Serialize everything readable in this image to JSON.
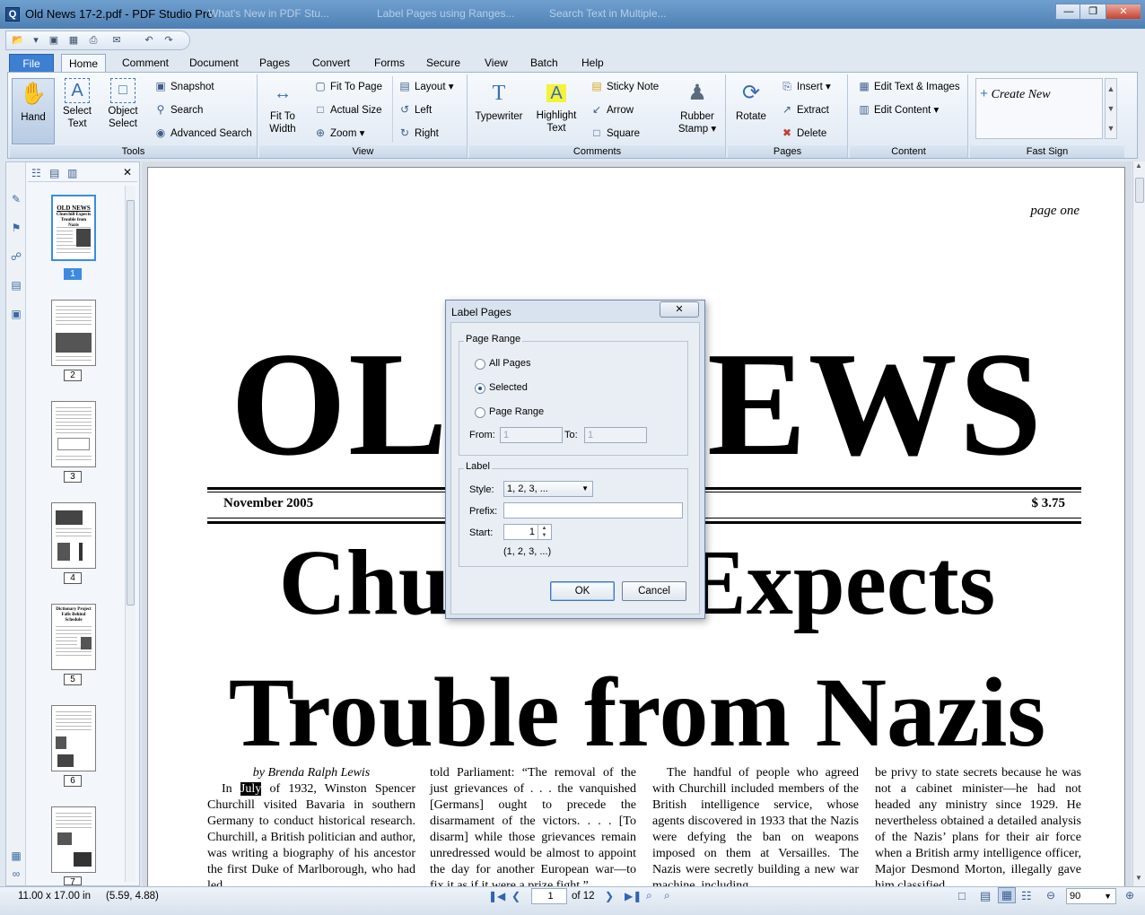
{
  "window": {
    "title": "Old News 17-2.pdf - PDF Studio Pro",
    "ghost_tabs": [
      "What's New in PDF Stu...",
      "Label Pages using Ranges...",
      "Search Text in Multiple..."
    ]
  },
  "menu_tabs": [
    "File",
    "Home",
    "Comment",
    "Document",
    "Pages",
    "Convert",
    "Forms",
    "Secure",
    "View",
    "Batch",
    "Help"
  ],
  "ribbon": {
    "tools": {
      "label": "Tools",
      "hand": "Hand",
      "select_text": "Select Text",
      "object_select": "Object Select",
      "snapshot": "Snapshot",
      "search": "Search",
      "advanced_search": "Advanced Search"
    },
    "view": {
      "label": "View",
      "fit_to_width": "Fit To Width",
      "fit_to_page": "Fit To Page",
      "actual_size": "Actual Size",
      "zoom": "Zoom",
      "layout": "Layout",
      "left": "Left",
      "right": "Right"
    },
    "comments": {
      "label": "Comments",
      "typewriter": "Typewriter",
      "highlight_text": "Highlight Text",
      "sticky_note": "Sticky Note",
      "arrow": "Arrow",
      "square": "Square",
      "rubber_stamp": "Rubber Stamp"
    },
    "pages": {
      "label": "Pages",
      "rotate": "Rotate",
      "insert": "Insert",
      "extract": "Extract",
      "delete": "Delete"
    },
    "content": {
      "label": "Content",
      "edit_text_images": "Edit Text & Images",
      "edit_content": "Edit Content"
    },
    "fast_sign": {
      "label": "Fast Sign",
      "create_new": "Create New"
    }
  },
  "thumbnails": {
    "pages": [
      "1",
      "2",
      "3",
      "4",
      "5",
      "6",
      "7"
    ],
    "selected": "1",
    "thumb1_title": "OLD NEWS",
    "thumb1_sub": "Churchill Expects Trouble from Nazis",
    "thumb5_title": "Dictionary Project Falls Behind Schedule"
  },
  "document": {
    "page_label": "page one",
    "masthead": "OLD NEWS",
    "date": "November 2005",
    "price": "$ 3.75",
    "headline1": "Churchill Expects",
    "headline2": "Trouble from Nazis",
    "byline": "by Brenda Ralph Lewis",
    "col1_in": "In",
    "col1_hl": "July",
    "col1_rest": "of 1932, Winston Spencer Churchill visited Bavaria in southern Germany to conduct historical research. Churchill, a British politician and author, was writing a biography of his ancestor the first Duke of Marlborough, who had led",
    "col2": "told Parliament: “The removal of the just grievances of . . . the vanquished [Germans] ought to precede the disarmament of the victors. . . . [To disarm] while those grievances remain unredressed would be almost to appoint the day for another European war—to fix it as if it were a prize fight.”",
    "col3": "The handful of people who agreed with Churchill included members of the British intelligence service, whose agents discovered in 1933 that the Nazis were defying the ban on weapons imposed on them at Versailles. The Nazis were secretly building a new war machine, including",
    "col4": "be privy to state secrets because he was not a cabinet minister—he had not headed any ministry since 1929. He nevertheless obtained a detailed analysis of the Nazis’ plans for their air force when a British army intelligence officer, Major Desmond Morton, illegally gave him classified"
  },
  "dialog": {
    "title": "Label Pages",
    "page_range_legend": "Page Range",
    "all_pages": "All Pages",
    "selected": "Selected",
    "page_range": "Page Range",
    "selected_option": "Selected",
    "from_label": "From:",
    "from_value": "1",
    "to_label": "To:",
    "to_value": "1",
    "label_legend": "Label",
    "style_label": "Style:",
    "style_value": "1, 2, 3, ...",
    "prefix_label": "Prefix:",
    "prefix_value": "",
    "start_label": "Start:",
    "start_value": "1",
    "preview": "(1, 2, 3, ...)",
    "ok": "OK",
    "cancel": "Cancel"
  },
  "status": {
    "page_size": "11.00 x 17.00 in",
    "cursor": "(5.59, 4.88)",
    "current_page": "1",
    "of_pages": "of 12",
    "zoom": "90"
  }
}
